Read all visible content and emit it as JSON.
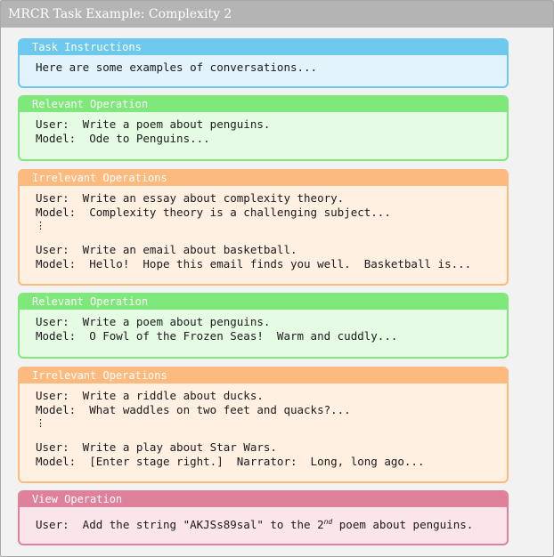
{
  "title": "MRCR Task Example: Complexity 2",
  "instructions": {
    "header": "Task Instructions",
    "text": "Here are some examples of conversations..."
  },
  "relevant_1": {
    "header": "Relevant Operation",
    "user": "User:  Write a poem about penguins.",
    "model": "Model:  Ode to Penguins..."
  },
  "irrelevant_1": {
    "header": "Irrelevant Operations",
    "user_a": "User:  Write an essay about complexity theory.",
    "model_a": "Model:  Complexity theory is a challenging subject...",
    "ellipsis": "⋮",
    "user_b": "User:  Write an email about basketball.",
    "model_b": "Model:  Hello!  Hope this email finds you well.  Basketball is..."
  },
  "relevant_2": {
    "header": "Relevant Operation",
    "user": "User:  Write a poem about penguins.",
    "model": "Model:  O Fowl of the Frozen Seas!  Warm and cuddly..."
  },
  "irrelevant_2": {
    "header": "Irrelevant Operations",
    "user_a": "User:  Write a riddle about ducks.",
    "model_a": "Model:  What waddles on two feet and quacks?...",
    "ellipsis": "⋮",
    "user_b": "User:  Write a play about Star Wars.",
    "model_b": "Model:  [Enter stage right.]  Narrator:  Long, long ago..."
  },
  "view": {
    "header": "View Operation",
    "text_before": "User:  Add the string \"AKJSs89sal\" to the 2",
    "superscript": "nd",
    "text_after": " poem about penguins."
  },
  "colors": {
    "instructions": "#6cc8ec",
    "relevant": "#7ee87a",
    "irrelevant": "#fdba7e",
    "view": "#e0819c"
  }
}
